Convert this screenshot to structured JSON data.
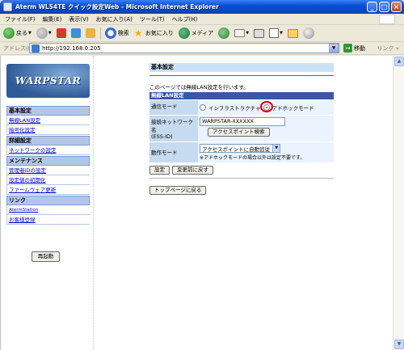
{
  "window": {
    "title": "Aterm WL54TE クイック設定Web - Microsoft Internet Explorer",
    "controls": [
      "_",
      "□",
      "×"
    ]
  },
  "menubar": [
    "ファイル(F)",
    "編集(E)",
    "表示(V)",
    "お気に入り(A)",
    "ツール(T)",
    "ヘルプ(H)"
  ],
  "toolbar": {
    "back_label": "戻る",
    "search_label": "検索",
    "favorites_label": "お気に入り",
    "media_label": "メディア"
  },
  "address": {
    "label": "アドレス(D)",
    "url": "http://192.168.0.205",
    "go_label": "移動",
    "links_label": "リンク »"
  },
  "sidebar": {
    "logo_text": "WARPSTAR",
    "restart_label": "再起動",
    "sections": [
      {
        "title": "基本設定",
        "items": [
          "無線LAN設定",
          "暗号化設定"
        ]
      },
      {
        "title": "詳細設定",
        "items": [
          "ネットワークの設定"
        ]
      },
      {
        "title": "メンテナンス",
        "items": [
          "管理者IDの設定",
          "設定値の初期化",
          "ファームウェア更新"
        ]
      },
      {
        "title": "リンク",
        "items": [
          "AtermStation",
          "お客様登録"
        ]
      }
    ]
  },
  "main": {
    "heading": "基本設定",
    "description": "このページでは無線LAN設定を行います。",
    "table_title": "無線LAN設定",
    "mode_label": "通信モード",
    "infra_label": "インフラストラクチャ",
    "adhoc_label": "アドホックモード",
    "ssid_label": "接続ネットワーク名\n(ESS-ID)",
    "ssid_value": "WARPSTAR-XXXXXX",
    "ap_search_label": "アクセスポイント検索",
    "op_mode_label": "動作モード",
    "op_mode_value": "アクセスポイントに自動追従",
    "op_mode_note": "※アドホックモードの場合以外は設定不要です。",
    "set_button": "設定",
    "revert_button": "変更前に戻す",
    "top_button": "トップページに戻る"
  },
  "colors": {
    "titlebar": "#0a4fd6",
    "section_bg": "#b4c6e8",
    "table_header": "#3a57a6",
    "label_cell": "#c6daf0",
    "highlight_circle": "#e00000"
  }
}
